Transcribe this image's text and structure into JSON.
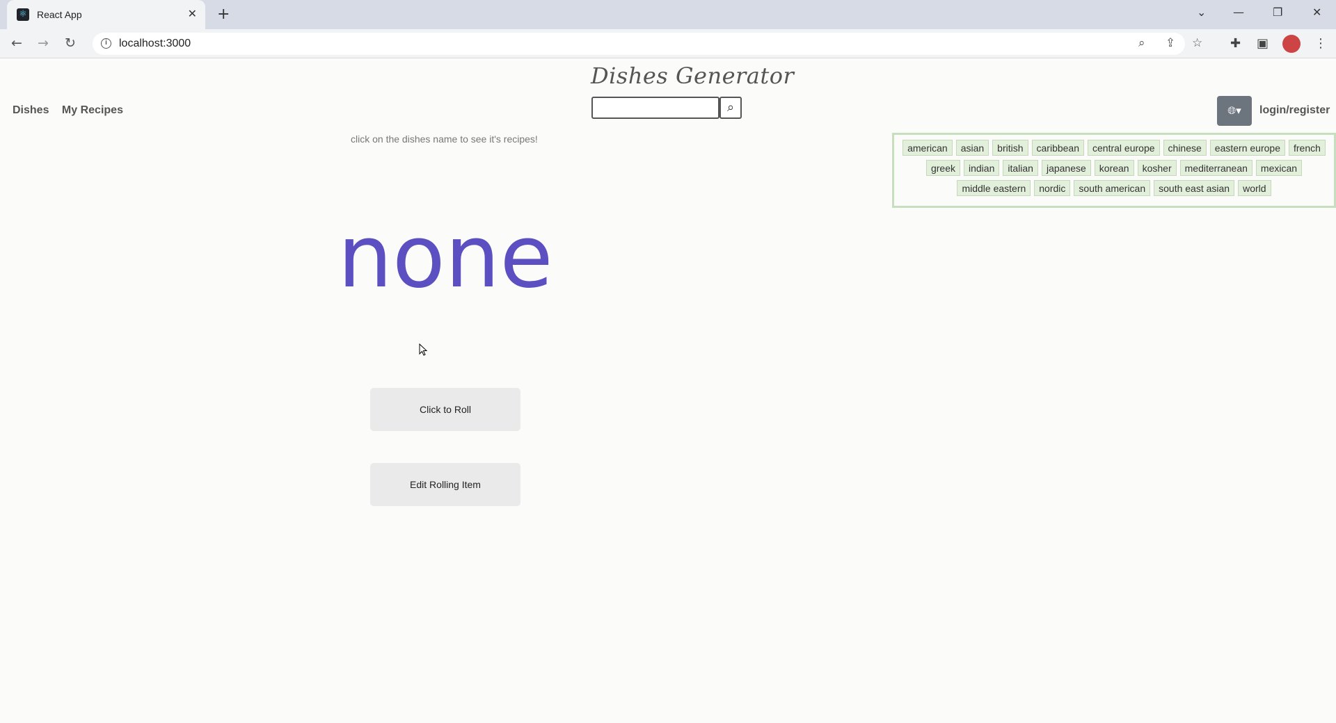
{
  "browser": {
    "tab_title": "React App",
    "url": "localhost:3000"
  },
  "page": {
    "brand": "Dishes Generator",
    "nav": [
      "Dishes",
      "My Recipes"
    ],
    "search": {
      "value": "",
      "placeholder": ""
    },
    "login_label": "login/register",
    "hint": "click on the dishes name to see it's recipes!",
    "dish_name": "none",
    "roll_button": "Click to Roll",
    "edit_button": "Edit Rolling Item",
    "cuisines": [
      "american",
      "asian",
      "british",
      "caribbean",
      "central europe",
      "chinese",
      "eastern europe",
      "french",
      "greek",
      "indian",
      "italian",
      "japanese",
      "korean",
      "kosher",
      "mediterranean",
      "mexican",
      "middle eastern",
      "nordic",
      "south american",
      "south east asian",
      "world"
    ]
  },
  "colors": {
    "accent": "#5b4fc1",
    "chip_bg": "#e2efda",
    "chip_border": "#c8dfbf"
  }
}
